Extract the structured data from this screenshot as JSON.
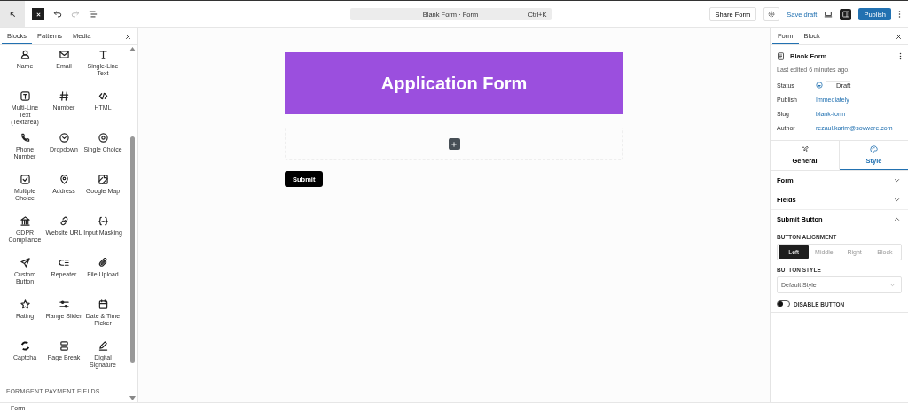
{
  "toolbar": {
    "command_bar": {
      "title": "Blank Form · Form",
      "shortcut": "Ctrl+K"
    },
    "share_button": "Share Form",
    "save_draft": "Save draft",
    "publish": "Publish"
  },
  "left_panel": {
    "tabs": [
      {
        "label": "Blocks",
        "selected": true
      },
      {
        "label": "Patterns",
        "selected": false
      },
      {
        "label": "Media",
        "selected": false
      }
    ],
    "blocks": [
      {
        "label": "Name"
      },
      {
        "label": "Email"
      },
      {
        "label": "Single-Line Text"
      },
      {
        "label": "Multi-Line Text (Textarea)"
      },
      {
        "label": "Number"
      },
      {
        "label": "HTML"
      },
      {
        "label": "Phone Number"
      },
      {
        "label": "Dropdown"
      },
      {
        "label": "Single Choice"
      },
      {
        "label": "Multiple Choice"
      },
      {
        "label": "Address"
      },
      {
        "label": "Google Map"
      },
      {
        "label": "GDPR Compliance"
      },
      {
        "label": "Website URL"
      },
      {
        "label": "Input Masking"
      },
      {
        "label": "Custom Button"
      },
      {
        "label": "Repeater"
      },
      {
        "label": "File Upload"
      },
      {
        "label": "Rating"
      },
      {
        "label": "Range Slider"
      },
      {
        "label": "Date & Time Picker"
      },
      {
        "label": "Captcha"
      },
      {
        "label": "Page Break"
      },
      {
        "label": "Digital Signature"
      }
    ],
    "section_heading": "FORMGENT PAYMENT FIELDS"
  },
  "canvas": {
    "header_title": "Application Form",
    "submit_label": "Submit"
  },
  "right_panel": {
    "tabs": [
      {
        "label": "Form",
        "selected": true
      },
      {
        "label": "Block",
        "selected": false
      }
    ],
    "form_title": "Blank Form",
    "last_edited": "Last edited 6 minutes ago.",
    "meta": [
      {
        "label": "Status",
        "value": "Draft",
        "kind": "status"
      },
      {
        "label": "Publish",
        "value": "Immediately",
        "kind": "link"
      },
      {
        "label": "Slug",
        "value": "blank-form",
        "kind": "link"
      },
      {
        "label": "Author",
        "value": "rezaul.karim@sovware.com",
        "kind": "link"
      }
    ],
    "style_tabs": [
      {
        "label": "General",
        "selected": false
      },
      {
        "label": "Style",
        "selected": true
      }
    ],
    "sections": [
      {
        "title": "Form",
        "expanded": false
      },
      {
        "title": "Fields",
        "expanded": false
      },
      {
        "title": "Submit Button",
        "expanded": true
      }
    ],
    "alignment_label": "BUTTON ALIGNMENT",
    "alignment_options": [
      {
        "label": "Left",
        "selected": true
      },
      {
        "label": "Middle",
        "selected": false
      },
      {
        "label": "Right",
        "selected": false
      },
      {
        "label": "Block",
        "selected": false
      }
    ],
    "style_label": "BUTTON STYLE",
    "style_value": "Default Style",
    "toggle": {
      "label": "DISABLE BUTTON",
      "on": false
    }
  },
  "status_bar": {
    "label": "Form"
  }
}
